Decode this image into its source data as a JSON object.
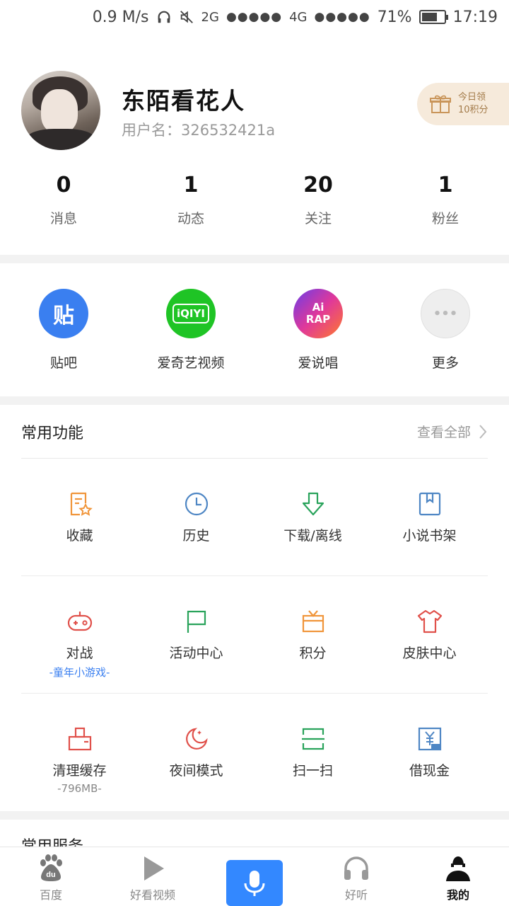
{
  "status_bar": {
    "speed": "0.9 M/s",
    "net1": "2G",
    "signal1": "●●●●●",
    "net2": "4G",
    "signal2": "●●●●●",
    "battery": "71%",
    "battery_level": 0.71,
    "time": "17:19"
  },
  "profile": {
    "nickname": "东陌看花人",
    "username": "用户名：326532421a",
    "signin_line1": "今日领",
    "signin_line2": "10积分"
  },
  "stats": [
    {
      "num": "0",
      "label": "消息"
    },
    {
      "num": "1",
      "label": "动态"
    },
    {
      "num": "20",
      "label": "关注"
    },
    {
      "num": "1",
      "label": "粉丝"
    }
  ],
  "apps": [
    {
      "label": "贴吧",
      "icon": "tieba-icon",
      "glyph": "贴",
      "color": "#3a7ff0"
    },
    {
      "label": "爱奇艺视频",
      "icon": "iqiyi-icon",
      "glyph": "iQIYI",
      "color": "#1fc425"
    },
    {
      "label": "爱说唱",
      "icon": "airap-icon",
      "glyph": "Ai RAP",
      "color": "#c03bd8"
    },
    {
      "label": "更多",
      "icon": "more-icon",
      "glyph": "•••",
      "color": "#eeeeee"
    }
  ],
  "common": {
    "title": "常用功能",
    "view_all": "查看全部"
  },
  "functions_row1": [
    {
      "label": "收藏",
      "icon": "favorites-icon",
      "color": "#f0953a"
    },
    {
      "label": "历史",
      "icon": "history-icon",
      "color": "#4e86c4"
    },
    {
      "label": "下载/离线",
      "icon": "download-icon",
      "color": "#29a35b"
    },
    {
      "label": "小说书架",
      "icon": "bookshelf-icon",
      "color": "#4e86c4"
    }
  ],
  "functions_row2": [
    {
      "label": "对战",
      "sub": "-童年小游戏-",
      "icon": "gamepad-icon",
      "color": "#e0504a"
    },
    {
      "label": "活动中心",
      "icon": "flag-icon",
      "color": "#29a35b"
    },
    {
      "label": "积分",
      "icon": "gift-box-icon",
      "color": "#f0953a"
    },
    {
      "label": "皮肤中心",
      "icon": "shirt-icon",
      "color": "#e0504a"
    }
  ],
  "functions_row3": [
    {
      "label": "清理缓存",
      "sub": "-796MB-",
      "icon": "clean-icon",
      "color": "#e0504a"
    },
    {
      "label": "夜间模式",
      "icon": "moon-icon",
      "color": "#e0504a"
    },
    {
      "label": "扫一扫",
      "icon": "scan-icon",
      "color": "#29a35b"
    },
    {
      "label": "借现金",
      "icon": "cash-icon",
      "color": "#4e86c4"
    }
  ],
  "services_title": "常用服务",
  "bottom_nav": [
    {
      "label": "百度",
      "icon": "baidu-paw-icon"
    },
    {
      "label": "好看视频",
      "icon": "play-icon"
    },
    {
      "label": "",
      "icon": "mic-icon"
    },
    {
      "label": "好听",
      "icon": "headphones-icon"
    },
    {
      "label": "我的",
      "icon": "profile-icon"
    }
  ]
}
